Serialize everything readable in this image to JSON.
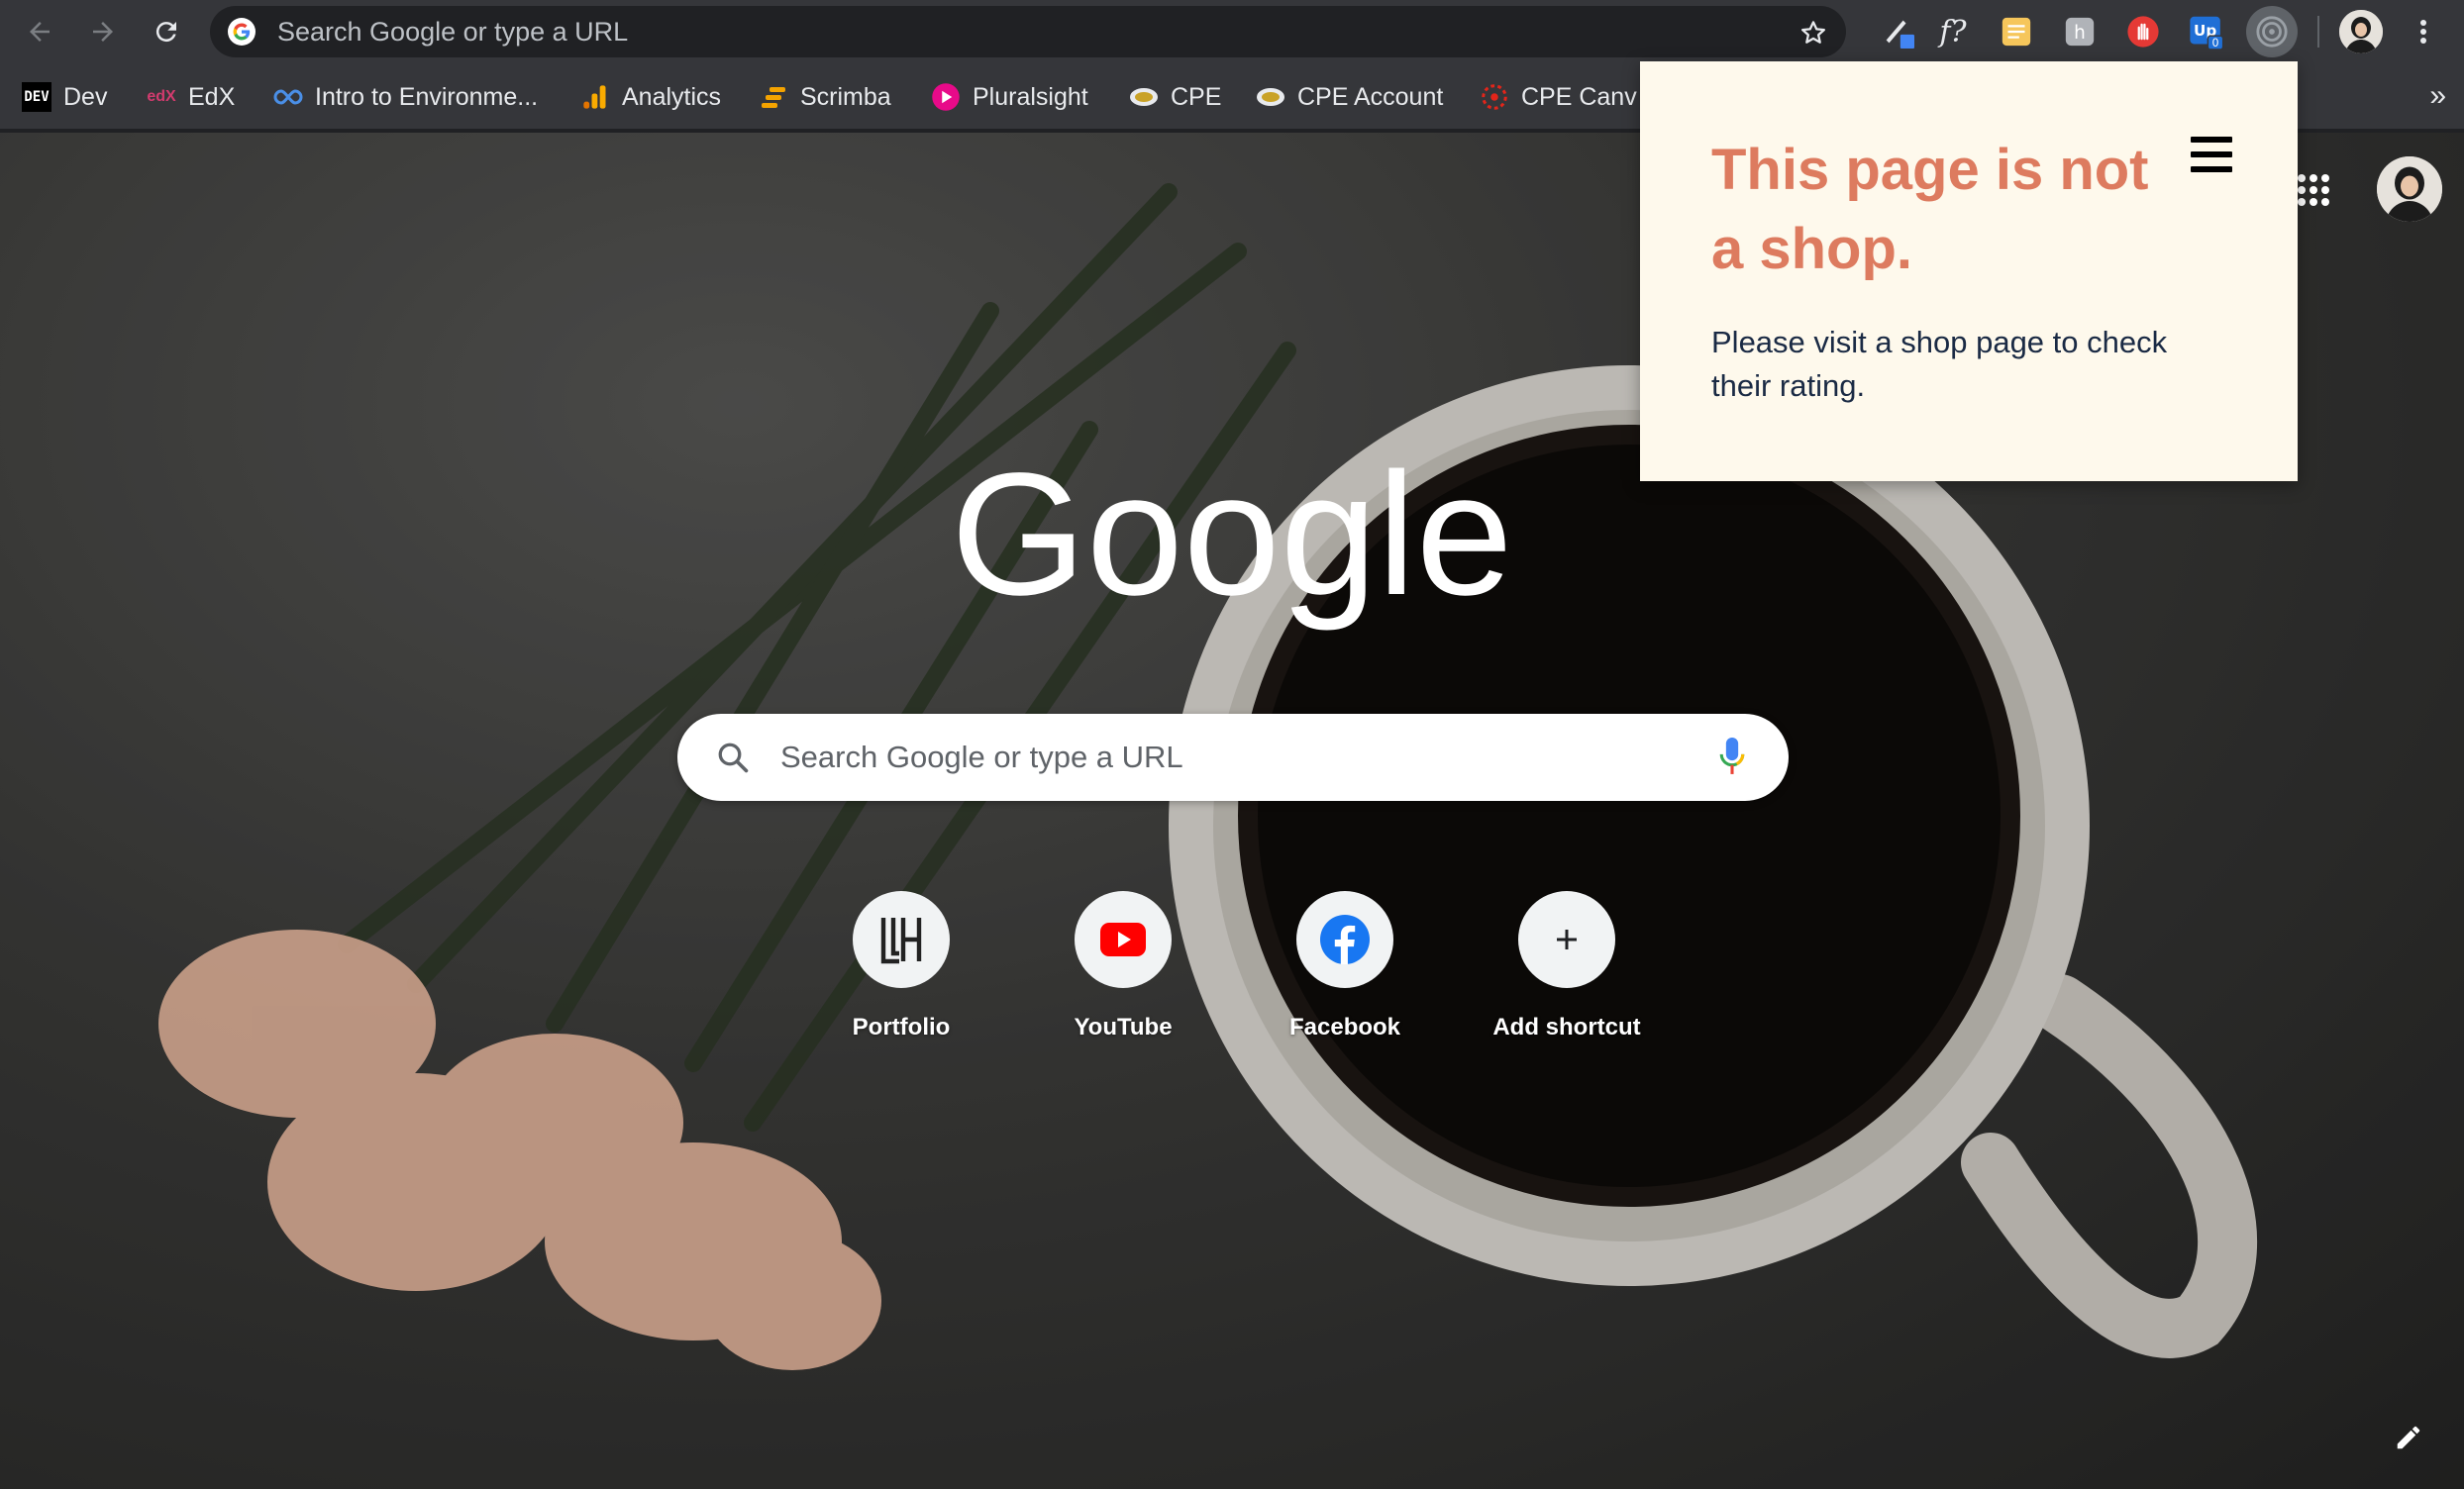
{
  "browser": {
    "omnibox_placeholder": "Search Google or type a URL",
    "extensions": [
      "pen-extension-icon",
      "formula-extension-icon",
      "notes-extension-icon",
      "hackmd-extension-icon",
      "stop-hand-extension-icon",
      "unpaywall-extension-icon",
      "shop-rating-extension-icon"
    ],
    "extension_badge": "0"
  },
  "bookmarks": [
    {
      "label": "Dev",
      "icon": "dev-icon"
    },
    {
      "label": "EdX",
      "icon": "edx-icon"
    },
    {
      "label": "Intro to Environme...",
      "icon": "infinity-icon"
    },
    {
      "label": "Analytics",
      "icon": "analytics-icon"
    },
    {
      "label": "Scrimba",
      "icon": "scrimba-icon"
    },
    {
      "label": "Pluralsight",
      "icon": "pluralsight-icon"
    },
    {
      "label": "CPE",
      "icon": "cpe-icon"
    },
    {
      "label": "CPE Account",
      "icon": "cpe-icon"
    },
    {
      "label": "CPE Canv",
      "icon": "canvas-icon"
    }
  ],
  "newtab": {
    "logo_text": "Google",
    "search_placeholder": "Search Google or type a URL",
    "shortcuts": [
      {
        "label": "Portfolio",
        "icon": "portfolio-lh-icon"
      },
      {
        "label": "YouTube",
        "icon": "youtube-icon"
      },
      {
        "label": "Facebook",
        "icon": "facebook-icon"
      },
      {
        "label": "Add shortcut",
        "icon": "plus-icon"
      }
    ]
  },
  "popup": {
    "title": "This page is not a shop.",
    "body": "Please visit a shop page to check their rating."
  },
  "colors": {
    "toolbar": "#35363a",
    "popup_bg": "#fef9ec",
    "popup_title": "#dd7b5f",
    "popup_body": "#1a2a44"
  }
}
